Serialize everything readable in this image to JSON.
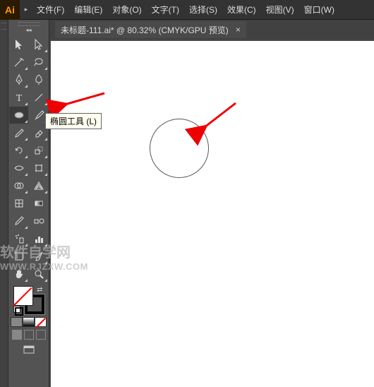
{
  "app": {
    "logo_text": "Ai",
    "collapse_glyph": "▸"
  },
  "menu": {
    "file": "文件(F)",
    "edit": "编辑(E)",
    "object": "对象(O)",
    "type": "文字(T)",
    "select": "选择(S)",
    "effect": "效果(C)",
    "view": "视图(V)",
    "window": "窗口(W)"
  },
  "tab": {
    "title": "未标题-111.ai* @ 80.32%  (CMYK/GPU 预览)",
    "close_glyph": "×"
  },
  "tooltip": {
    "text": "椭圆工具 (L)"
  },
  "toolbox": {
    "collapse_glyph": "◂◂"
  },
  "watermark": {
    "line1": "软件自学网",
    "line2": "WWW.RJZXW.COM"
  },
  "tools": {
    "selection": "selection",
    "direct_selection": "direct-selection",
    "magic_wand": "magic-wand",
    "lasso": "lasso",
    "pen": "pen",
    "curvature_pen": "curvature-pen",
    "type": "type",
    "line": "line",
    "ellipse": "ellipse",
    "paintbrush": "paintbrush",
    "shaper": "shaper",
    "eraser": "eraser",
    "rotate": "rotate",
    "scale": "scale",
    "width": "width",
    "free_transform": "free-transform",
    "shape_builder": "shape-builder",
    "perspective": "perspective",
    "mesh": "mesh",
    "gradient": "gradient",
    "eyedropper": "eyedropper",
    "blend": "blend",
    "symbol_sprayer": "symbol-sprayer",
    "column_graph": "column-graph",
    "artboard": "artboard",
    "slice": "slice",
    "hand": "hand",
    "zoom": "zoom"
  }
}
